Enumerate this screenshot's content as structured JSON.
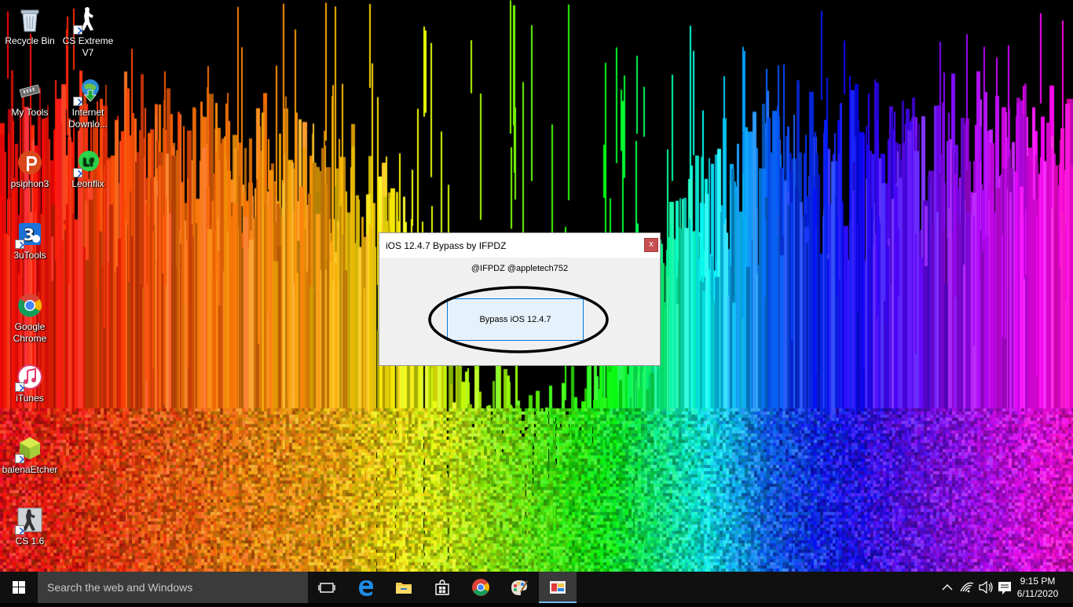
{
  "desktop": {
    "icons": [
      {
        "label": "Recycle Bin",
        "icon": "recycle-bin-icon"
      },
      {
        "label": "CS Extreme V7",
        "icon": "counter-strike-icon"
      },
      {
        "label": "My Tools",
        "icon": "folder-tools-icon"
      },
      {
        "label": "Internet Downlo...",
        "icon": "internet-download-manager-icon"
      },
      {
        "label": "psiphon3",
        "icon": "psiphon-icon"
      },
      {
        "label": "Leonflix",
        "icon": "leonflix-icon"
      },
      {
        "label": "3uTools",
        "icon": "3utools-icon"
      },
      {
        "label": "Google Chrome",
        "icon": "chrome-icon"
      },
      {
        "label": "iTunes",
        "icon": "itunes-icon"
      },
      {
        "label": "balenaEtcher",
        "icon": "balena-etcher-icon"
      },
      {
        "label": "CS 1.6",
        "icon": "counter-strike-icon"
      }
    ]
  },
  "dialog": {
    "title": "iOS 12.4.7 Bypass by IFPDZ",
    "close_label": "x",
    "credits": "@IFPDZ  @appletech752",
    "button_label": "Bypass iOS 12.4.7"
  },
  "taskbar": {
    "search_placeholder": "Search the web and Windows",
    "apps": [
      "task-view-icon",
      "edge-icon",
      "file-explorer-icon",
      "store-icon",
      "chrome-icon",
      "paint-icon",
      "bypass-tool-icon"
    ],
    "tray": {
      "time": "9:15 PM",
      "date": "6/11/2020"
    }
  },
  "colors": {
    "accent": "#0078d7",
    "close_button": "#c75050",
    "taskbar": "#101010",
    "search_box": "#3b3b3b"
  }
}
